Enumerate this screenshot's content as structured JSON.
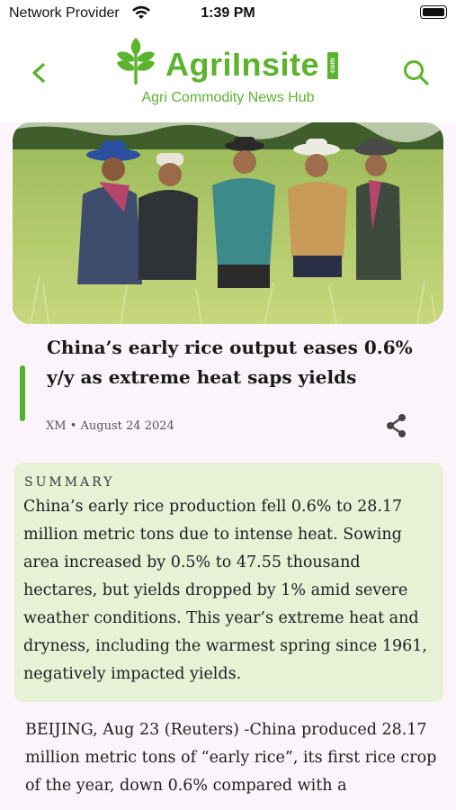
{
  "status_bar": {
    "carrier": "Network Provider",
    "time": "1:39 PM",
    "wifi_icon": "wifi-icon",
    "battery_icon": "battery-icon"
  },
  "header": {
    "back_icon": "chevron-left-icon",
    "logo_text": "AgriInsite",
    "logo_badge": "com",
    "tagline": "Agri Commodity News Hub",
    "search_icon": "search-icon",
    "brand_color": "#5cb32e"
  },
  "article": {
    "hero_image_alt": "Officials in hats inspecting a rice field",
    "headline": "China’s early rice output eases 0.6% y/y as extreme heat saps yields",
    "source": "XM",
    "date": "August 24 2024",
    "meta_separator": "•",
    "share_icon": "share-icon",
    "accent_color": "#4cb32a"
  },
  "summary": {
    "label": "SUMMARY",
    "text": "China’s early rice production fell 0.6% to 28.17 million metric tons due to intense heat. Sowing area increased by 0.5% to 47.55 thousand hectares, but yields dropped by 1% amid severe weather conditions. This year’s extreme heat and dryness, including the warmest spring since 1961, negatively impacted yields.",
    "background": "#e6f1d6"
  },
  "body": {
    "text": "BEIJING, Aug 23 (Reuters) -China produced 28.17 million metric tons of “early rice”, its first rice crop of the year, down 0.6% compared with a"
  }
}
